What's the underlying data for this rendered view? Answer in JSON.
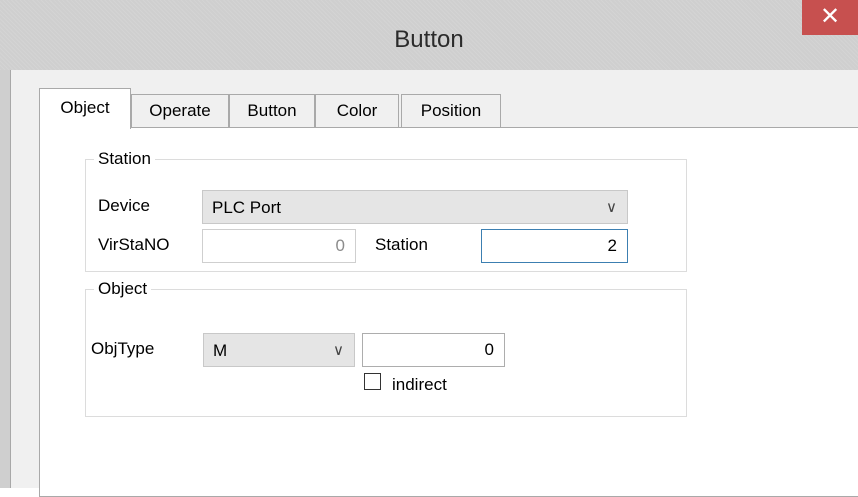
{
  "window": {
    "title": "Button",
    "close_glyph": "✕"
  },
  "tabs": [
    {
      "label": "Object",
      "active": true
    },
    {
      "label": "Operate",
      "active": false
    },
    {
      "label": "Button",
      "active": false
    },
    {
      "label": "Color",
      "active": false
    },
    {
      "label": "Position",
      "active": false
    }
  ],
  "station": {
    "group_label": "Station",
    "device_label": "Device",
    "device_value": "PLC Port",
    "virsta_label": "VirStaNO",
    "virsta_value": "0",
    "station_label": "Station",
    "station_value": "2"
  },
  "object": {
    "group_label": "Object",
    "objtype_label": "ObjType",
    "objtype_value": "M",
    "address_value": "0",
    "indirect_label": "indirect",
    "indirect_checked": false
  },
  "icons": {
    "dropdown": "chevron-down-icon",
    "close": "close-icon"
  },
  "colors": {
    "close_button": "#c7504f",
    "focus_border": "#3c7fb1"
  }
}
